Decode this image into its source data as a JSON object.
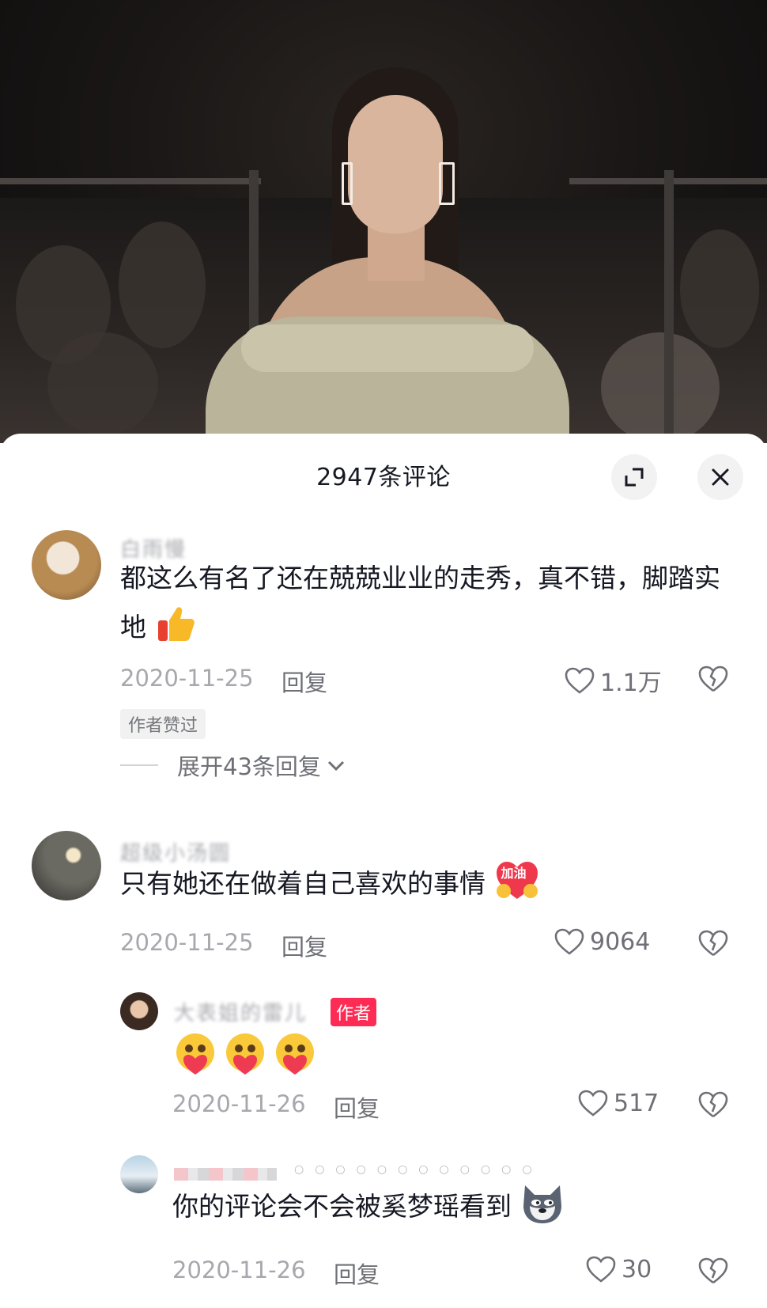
{
  "sheet": {
    "title": "2947条评论",
    "expand_icon": "expand-icon",
    "close_icon": "close-icon"
  },
  "comments": [
    {
      "username": "白雨慢",
      "text": "都这么有名了还在兢兢业业的走秀，真不错，脚踏实地",
      "emoji": "thumbs-up",
      "date": "2020-11-25",
      "reply_label": "回复",
      "likes": "1.1万",
      "badge": "作者赞过",
      "expand_label": "展开43条回复"
    },
    {
      "username": "超级小汤圆",
      "text": "只有她还在做着自己喜欢的事情",
      "emoji_text": "加油",
      "date": "2020-11-25",
      "reply_label": "回复",
      "likes": "9064"
    }
  ],
  "replies": [
    {
      "username": "大表姐的雷儿",
      "author_badge": "作者",
      "emoji": "heart-hug x3",
      "date": "2020-11-26",
      "reply_label": "回复",
      "likes": "517"
    },
    {
      "text": "你的评论会不会被奚梦瑶看到",
      "emoji": "husky",
      "date": "2020-11-26",
      "reply_label": "回复",
      "likes": "30"
    }
  ],
  "colors": {
    "accent": "#fe2c55",
    "primary_text": "#161823",
    "secondary_text": "#a7a8ad"
  }
}
